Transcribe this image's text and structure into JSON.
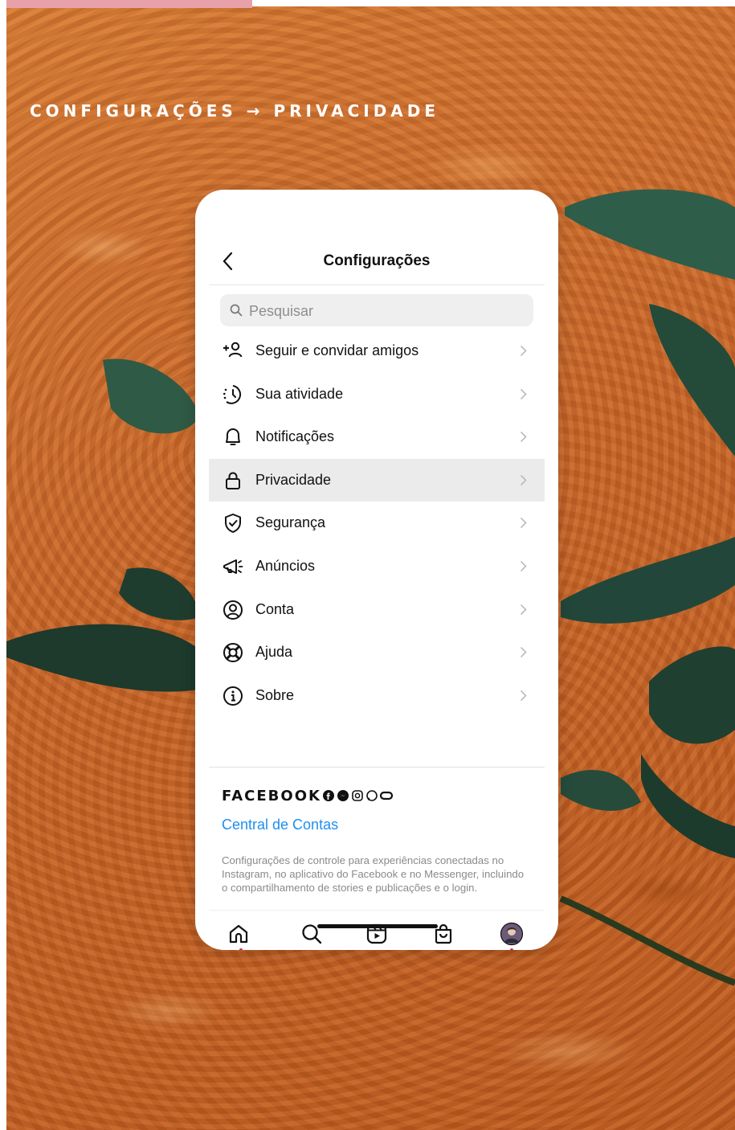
{
  "breadcrumb": "CONFIGURAÇÕES → PRIVACIDADE",
  "header": {
    "title": "Configurações"
  },
  "search": {
    "placeholder": "Pesquisar"
  },
  "menu": [
    {
      "label": "Seguir e convidar amigos",
      "icon": "add-person-icon"
    },
    {
      "label": "Sua atividade",
      "icon": "activity-clock-icon"
    },
    {
      "label": "Notificações",
      "icon": "bell-icon"
    },
    {
      "label": "Privacidade",
      "icon": "lock-icon",
      "selected": true
    },
    {
      "label": "Segurança",
      "icon": "shield-check-icon"
    },
    {
      "label": "Anúncios",
      "icon": "megaphone-icon"
    },
    {
      "label": "Conta",
      "icon": "account-circle-icon"
    },
    {
      "label": "Ajuda",
      "icon": "lifebuoy-icon"
    },
    {
      "label": "Sobre",
      "icon": "info-icon"
    }
  ],
  "facebook": {
    "label": "FACEBOOK",
    "link": "Central de Contas",
    "description": "Configurações de controle para experiências conectadas no Instagram, no aplicativo do Facebook e no Messenger, incluindo o compartilhamento de stories e publicações e o login."
  },
  "tabbar": [
    "home-icon",
    "search-icon",
    "reels-icon",
    "shop-bag-icon",
    "profile-avatar"
  ],
  "colors": {
    "accent": "#1d8ff2",
    "selected_row": "#ebebeb",
    "notification_dot": "#e0245e",
    "background": "#c8692a"
  }
}
